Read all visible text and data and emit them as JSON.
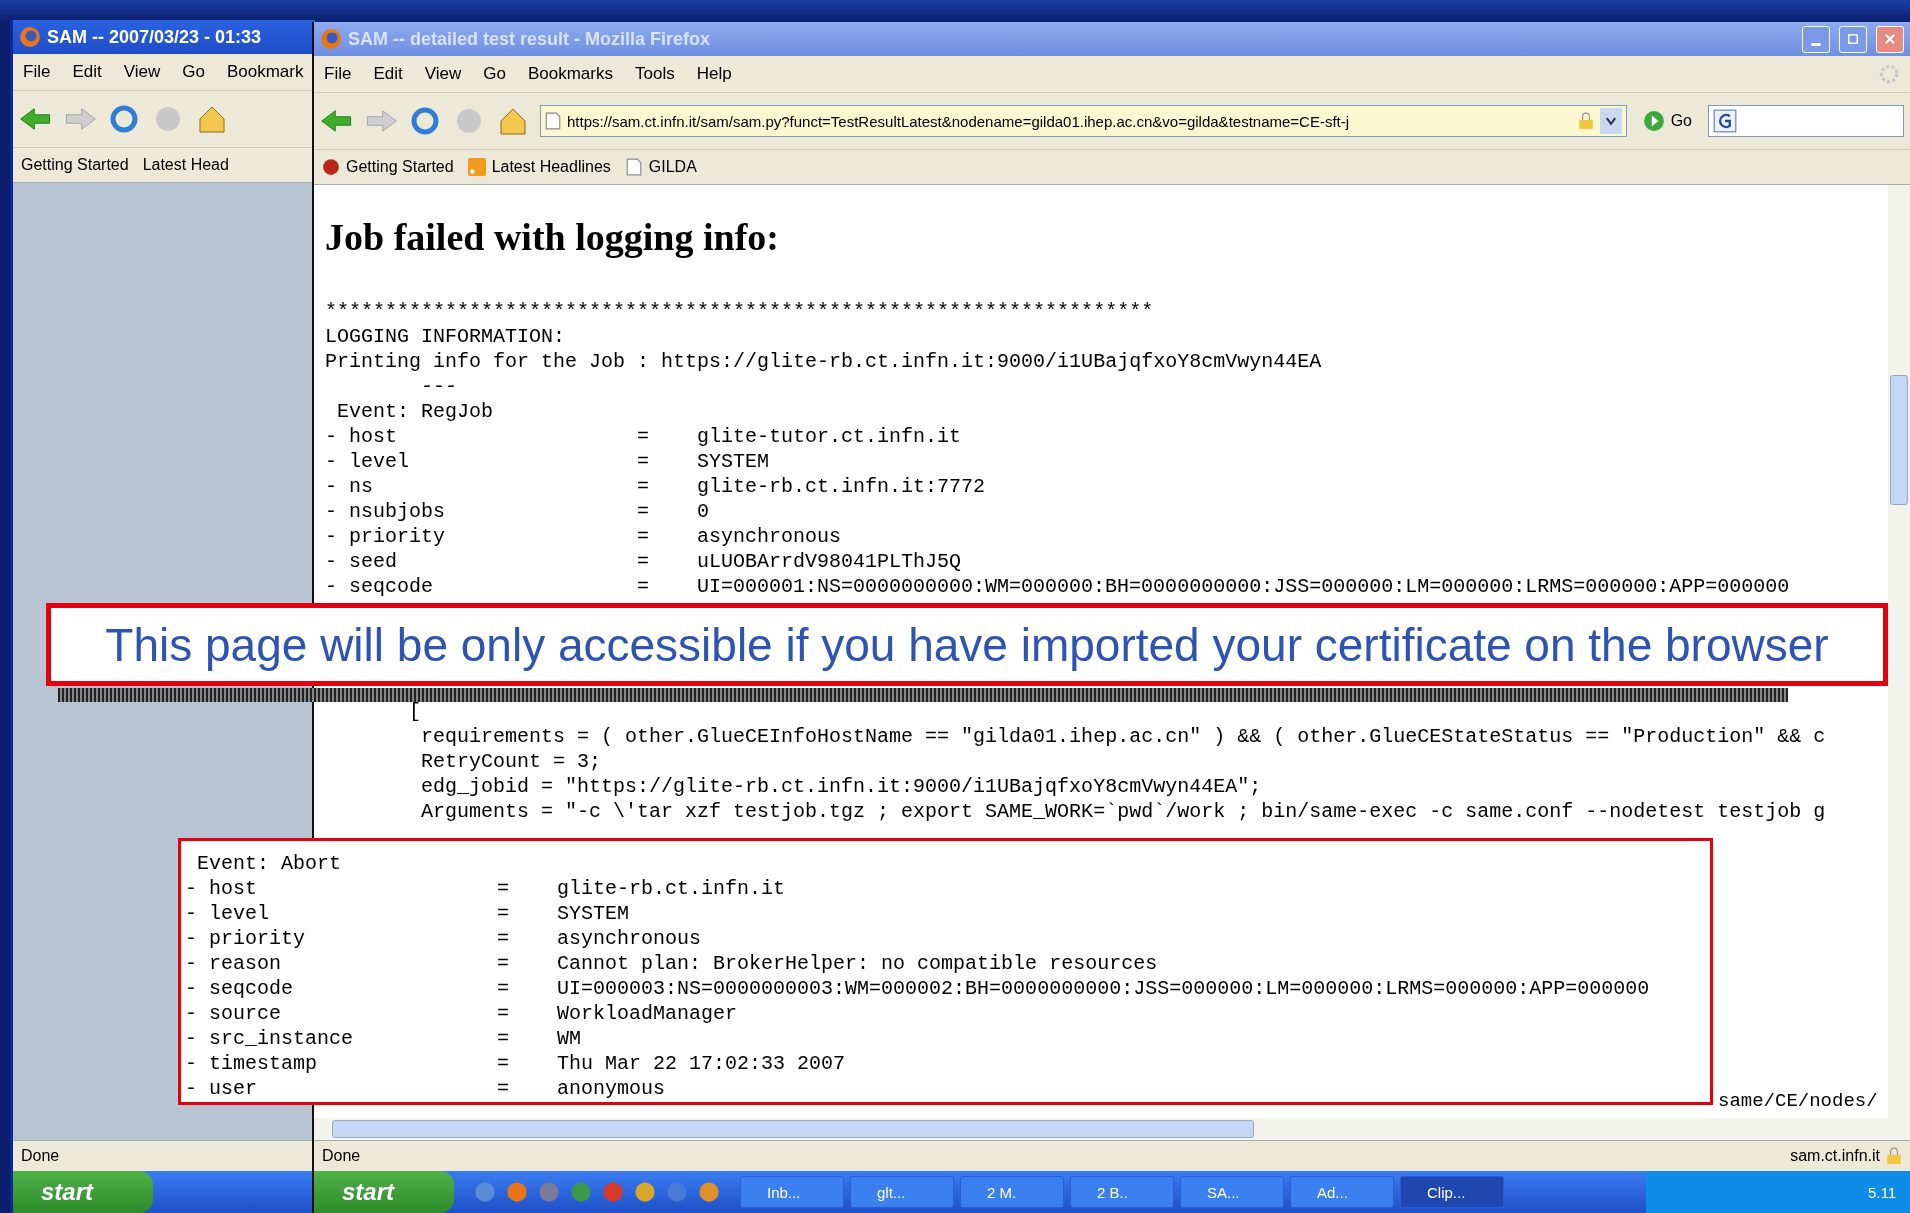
{
  "back_window": {
    "title": "SAM -- 2007/03/23 - 01:33",
    "menu": [
      "File",
      "Edit",
      "View",
      "Go",
      "Bookmark"
    ],
    "bookmarks": [
      "Getting Started",
      "Latest Head"
    ],
    "status": "Done",
    "start": "start"
  },
  "front_window": {
    "title": "SAM -- detailed test result - Mozilla Firefox",
    "menu": [
      "File",
      "Edit",
      "View",
      "Go",
      "Bookmarks",
      "Tools",
      "Help"
    ],
    "address": "https://sam.ct.infn.it/sam/sam.py?funct=TestResultLatest&nodename=gilda01.ihep.ac.cn&vo=gilda&testname=CE-sft-j",
    "go": "Go",
    "bookmarks": [
      {
        "label": "Getting Started",
        "kind": "site"
      },
      {
        "label": "Latest Headlines",
        "kind": "feed"
      },
      {
        "label": "GILDA",
        "kind": "page"
      }
    ],
    "heading": "Job failed with logging info:",
    "log_head": [
      "*********************************************************************",
      "LOGGING INFORMATION:",
      "Printing info for the Job : https://glite-rb.ct.infn.it:9000/i1UBajqfxoY8cmVwyn44EA",
      "        ---",
      " Event: RegJob"
    ],
    "log_fields": [
      {
        "key": "- host",
        "sep": "=",
        "value": "glite-tutor.ct.infn.it"
      },
      {
        "key": "- level",
        "sep": "=",
        "value": "SYSTEM"
      },
      {
        "key": "- ns",
        "sep": "=",
        "value": "glite-rb.ct.infn.it:7772"
      },
      {
        "key": "- nsubjobs",
        "sep": "=",
        "value": "0"
      },
      {
        "key": "- priority",
        "sep": "=",
        "value": "asynchronous"
      },
      {
        "key": "- seed",
        "sep": "=",
        "value": "uLUOBArrdV98041PLThJ5Q"
      },
      {
        "key": "- seqcode",
        "sep": "=",
        "value": "UI=000001:NS=0000000000:WM=000000:BH=0000000000:JSS=000000:LM=000000:LRMS=000000:APP=000000"
      }
    ],
    "log_tail": [
      "       [",
      "        requirements = ( other.GlueCEInfoHostName == \"gilda01.ihep.ac.cn\" ) && ( other.GlueCEStateStatus == \"Production\" && c",
      "        RetryCount = 3;",
      "        edg_jobid = \"https://glite-rb.ct.infn.it:9000/i1UBajqfxoY8cmVwyn44EA\";",
      "        Arguments = \"-c \\'tar xzf testjob.tgz ; export SAME_WORK=`pwd`/work ; bin/same-exec -c same.conf --nodetest testjob g"
    ],
    "path_fragment": "same/CE/nodes/",
    "status": "Done",
    "status_host": "sam.ct.infn.it"
  },
  "taskbar": {
    "start": "start",
    "tasks": [
      {
        "label": "Inb...",
        "selected": false
      },
      {
        "label": "glt...",
        "selected": false
      },
      {
        "label": "2 M.",
        "selected": false
      },
      {
        "label": "2 B..",
        "selected": false
      },
      {
        "label": "SA...",
        "selected": false
      },
      {
        "label": "Ad...",
        "selected": false
      },
      {
        "label": "Clip...",
        "selected": true
      }
    ],
    "clock": "5.11"
  },
  "callout_note": "This page will be only accessible if you have imported your certificate on the browser",
  "callout_log": {
    "event": " Event: Abort",
    "fields": [
      {
        "key": "- host",
        "sep": "=",
        "value": "glite-rb.ct.infn.it"
      },
      {
        "key": "- level",
        "sep": "=",
        "value": "SYSTEM"
      },
      {
        "key": "- priority",
        "sep": "=",
        "value": "asynchronous"
      },
      {
        "key": "- reason",
        "sep": "=",
        "value": "Cannot plan: BrokerHelper: no compatible resources"
      },
      {
        "key": "- seqcode",
        "sep": "=",
        "value": "UI=000003:NS=0000000003:WM=000002:BH=0000000000:JSS=000000:LM=000000:LRMS=000000:APP=000000"
      },
      {
        "key": "- source",
        "sep": "=",
        "value": "WorkloadManager"
      },
      {
        "key": "- src_instance",
        "sep": "=",
        "value": "WM"
      },
      {
        "key": "- timestamp",
        "sep": "=",
        "value": "Thu Mar 22 17:02:33 2007"
      },
      {
        "key": "- user",
        "sep": "=",
        "value": "anonymous"
      }
    ]
  }
}
